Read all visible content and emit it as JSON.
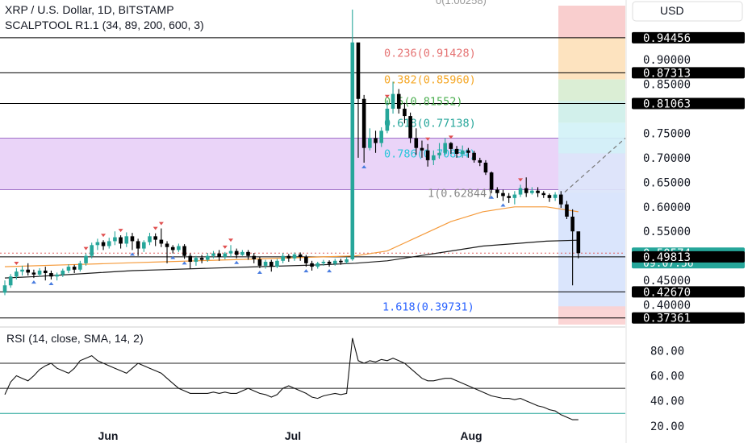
{
  "header": {
    "title": "XRP / U.S. Dollar, 1D, BITSTAMP",
    "indicator": "SCALPTOOL R1.1 (34, 89, 200, 600, 3)",
    "top_cut_label": "0(1.00258)"
  },
  "currency_label": "USD",
  "rsi_panel": {
    "label": "RSI (14, close, SMA, 14, 2)"
  },
  "colors": {
    "up": "#26a69a",
    "down": "#000000",
    "purple_zone": "#e6ccf7",
    "blue_zone": "#d4e1fb",
    "orange_line": "#f59a3a",
    "black_line": "#1a1a1a"
  },
  "chart_data": [
    {
      "type": "candlestick",
      "title": "XRP / U.S. Dollar, 1D, BITSTAMP",
      "ylim": [
        0.36,
        1.01
      ],
      "x_ticks": [
        "Jun",
        "Jul",
        "Aug"
      ],
      "y_ticks": [
        "0.90000",
        "0.85000",
        "0.75000",
        "0.70000",
        "0.65000",
        "0.60000",
        "0.55000",
        "0.45000",
        "0.40000"
      ],
      "price_badges": [
        {
          "value": "0.94456",
          "style": "dark"
        },
        {
          "value": "0.87313",
          "style": "dark"
        },
        {
          "value": "0.81063",
          "style": "dark"
        },
        {
          "value": "0.50574",
          "sub": "09:07:56",
          "style": "green"
        },
        {
          "value": "0.49813",
          "style": "dark"
        },
        {
          "value": "0.42670",
          "style": "dark"
        },
        {
          "value": "0.37361",
          "style": "dark"
        }
      ],
      "horizontal_levels": [
        0.94456,
        0.87313,
        0.81063,
        0.49813,
        0.4267,
        0.37361
      ],
      "fib_levels": [
        {
          "label": "0.236(0.91428)",
          "value": 0.91428,
          "color": "#e57373"
        },
        {
          "label": "0.382(0.85960)",
          "value": 0.8596,
          "color": "#f5a623"
        },
        {
          "label": "0.5(0.81552)",
          "value": 0.81552,
          "color": "#4caf50"
        },
        {
          "label": "0.618(0.77138)",
          "value": 0.77138,
          "color": "#26a69a"
        },
        {
          "label": "0.786(0.70854)",
          "value": 0.70854,
          "color": "#26c6da"
        },
        {
          "label": "1(0.62844)",
          "value": 0.62844,
          "color": "#888888"
        },
        {
          "label": "1.618(0.39731)",
          "value": 0.39731,
          "color": "#2962ff"
        }
      ],
      "zones": [
        {
          "name": "purple",
          "from": 0.635,
          "to": 0.74
        },
        {
          "name": "blue",
          "from": 0.39,
          "to": 0.635
        }
      ],
      "fib_band_colors": [
        "#f8c9c9",
        "#fde0b8",
        "#d7ecd0",
        "#cdeee9",
        "#d2f2f7",
        "#dde6fa",
        "#fbd0d0"
      ],
      "projection": {
        "from": 0.63,
        "to": 0.74
      },
      "candles": [
        [
          0.425,
          0.44,
          0.45,
          0.42
        ],
        [
          0.44,
          0.458,
          0.463,
          0.435
        ],
        [
          0.458,
          0.468,
          0.475,
          0.452
        ],
        [
          0.468,
          0.472,
          0.48,
          0.46
        ],
        [
          0.472,
          0.466,
          0.485,
          0.46
        ],
        [
          0.466,
          0.462,
          0.472,
          0.455
        ],
        [
          0.462,
          0.47,
          0.475,
          0.458
        ],
        [
          0.47,
          0.465,
          0.478,
          0.45
        ],
        [
          0.465,
          0.458,
          0.47,
          0.452
        ],
        [
          0.458,
          0.462,
          0.466,
          0.45
        ],
        [
          0.462,
          0.47,
          0.474,
          0.457
        ],
        [
          0.47,
          0.478,
          0.483,
          0.465
        ],
        [
          0.478,
          0.472,
          0.482,
          0.465
        ],
        [
          0.472,
          0.485,
          0.49,
          0.468
        ],
        [
          0.485,
          0.5,
          0.505,
          0.48
        ],
        [
          0.5,
          0.522,
          0.527,
          0.495
        ],
        [
          0.522,
          0.528,
          0.535,
          0.512
        ],
        [
          0.528,
          0.52,
          0.532,
          0.512
        ],
        [
          0.52,
          0.53,
          0.537,
          0.515
        ],
        [
          0.53,
          0.538,
          0.55,
          0.522
        ],
        [
          0.538,
          0.525,
          0.542,
          0.515
        ],
        [
          0.525,
          0.54,
          0.548,
          0.518
        ],
        [
          0.54,
          0.53,
          0.547,
          0.512
        ],
        [
          0.53,
          0.515,
          0.535,
          0.5
        ],
        [
          0.515,
          0.528,
          0.532,
          0.508
        ],
        [
          0.528,
          0.54,
          0.547,
          0.522
        ],
        [
          0.54,
          0.533,
          0.546,
          0.52
        ],
        [
          0.533,
          0.525,
          0.556,
          0.518
        ],
        [
          0.525,
          0.518,
          0.53,
          0.485
        ],
        [
          0.518,
          0.512,
          0.522,
          0.505
        ],
        [
          0.512,
          0.52,
          0.525,
          0.508
        ],
        [
          0.52,
          0.5,
          0.524,
          0.494
        ],
        [
          0.5,
          0.488,
          0.505,
          0.474
        ],
        [
          0.488,
          0.496,
          0.5,
          0.48
        ],
        [
          0.496,
          0.492,
          0.502,
          0.485
        ],
        [
          0.492,
          0.5,
          0.506,
          0.488
        ],
        [
          0.5,
          0.505,
          0.51,
          0.495
        ],
        [
          0.505,
          0.498,
          0.512,
          0.49
        ],
        [
          0.498,
          0.505,
          0.508,
          0.493
        ],
        [
          0.505,
          0.51,
          0.522,
          0.498
        ],
        [
          0.51,
          0.502,
          0.515,
          0.495
        ],
        [
          0.502,
          0.508,
          0.512,
          0.5
        ],
        [
          0.508,
          0.5,
          0.512,
          0.492
        ],
        [
          0.5,
          0.493,
          0.506,
          0.485
        ],
        [
          0.493,
          0.48,
          0.498,
          0.475
        ],
        [
          0.48,
          0.488,
          0.492,
          0.474
        ],
        [
          0.488,
          0.478,
          0.492,
          0.468
        ],
        [
          0.478,
          0.49,
          0.494,
          0.475
        ],
        [
          0.49,
          0.5,
          0.506,
          0.485
        ],
        [
          0.5,
          0.495,
          0.504,
          0.488
        ],
        [
          0.495,
          0.503,
          0.507,
          0.49
        ],
        [
          0.503,
          0.498,
          0.507,
          0.49
        ],
        [
          0.498,
          0.485,
          0.502,
          0.478
        ],
        [
          0.485,
          0.478,
          0.49,
          0.47
        ],
        [
          0.478,
          0.485,
          0.488,
          0.474
        ],
        [
          0.485,
          0.488,
          0.492,
          0.48
        ],
        [
          0.488,
          0.484,
          0.491,
          0.478
        ],
        [
          0.484,
          0.49,
          0.494,
          0.48
        ],
        [
          0.49,
          0.487,
          0.494,
          0.482
        ],
        [
          0.487,
          0.493,
          0.498,
          0.484
        ],
        [
          0.493,
          0.935,
          1.002,
          0.49
        ],
        [
          0.935,
          0.82,
          0.93,
          0.7
        ],
        [
          0.82,
          0.72,
          0.828,
          0.69
        ],
        [
          0.72,
          0.74,
          0.76,
          0.715
        ],
        [
          0.74,
          0.73,
          0.755,
          0.71
        ],
        [
          0.73,
          0.755,
          0.762,
          0.722
        ],
        [
          0.755,
          0.8,
          0.815,
          0.75
        ],
        [
          0.8,
          0.83,
          0.855,
          0.79
        ],
        [
          0.83,
          0.8,
          0.84,
          0.79
        ],
        [
          0.8,
          0.785,
          0.812,
          0.77
        ],
        [
          0.785,
          0.74,
          0.792,
          0.73
        ],
        [
          0.74,
          0.72,
          0.76,
          0.706
        ],
        [
          0.72,
          0.715,
          0.735,
          0.7
        ],
        [
          0.715,
          0.695,
          0.728,
          0.682
        ],
        [
          0.695,
          0.705,
          0.715,
          0.685
        ],
        [
          0.705,
          0.71,
          0.73,
          0.698
        ],
        [
          0.71,
          0.73,
          0.74,
          0.705
        ],
        [
          0.73,
          0.718,
          0.732,
          0.708
        ],
        [
          0.718,
          0.708,
          0.724,
          0.7
        ],
        [
          0.708,
          0.715,
          0.725,
          0.7
        ],
        [
          0.715,
          0.71,
          0.72,
          0.7
        ],
        [
          0.71,
          0.695,
          0.714,
          0.69
        ],
        [
          0.695,
          0.69,
          0.7,
          0.683
        ],
        [
          0.69,
          0.67,
          0.695,
          0.665
        ],
        [
          0.67,
          0.635,
          0.672,
          0.628
        ],
        [
          0.635,
          0.628,
          0.64,
          0.618
        ],
        [
          0.628,
          0.622,
          0.635,
          0.612
        ],
        [
          0.622,
          0.618,
          0.628,
          0.608
        ],
        [
          0.618,
          0.625,
          0.632,
          0.605
        ],
        [
          0.625,
          0.638,
          0.645,
          0.62
        ],
        [
          0.638,
          0.628,
          0.66,
          0.62
        ],
        [
          0.628,
          0.633,
          0.64,
          0.625
        ],
        [
          0.633,
          0.628,
          0.64,
          0.62
        ],
        [
          0.628,
          0.624,
          0.632,
          0.618
        ],
        [
          0.624,
          0.618,
          0.627,
          0.61
        ],
        [
          0.618,
          0.625,
          0.63,
          0.612
        ],
        [
          0.625,
          0.605,
          0.632,
          0.598
        ],
        [
          0.605,
          0.58,
          0.612,
          0.575
        ],
        [
          0.58,
          0.55,
          0.595,
          0.44
        ],
        [
          0.55,
          0.5057,
          0.535,
          0.495
        ]
      ],
      "up_markers": [
        2,
        14,
        17,
        20,
        26,
        27,
        38,
        39,
        66,
        73,
        77,
        89
      ],
      "down_markers": [
        5,
        8,
        22,
        29,
        31,
        40,
        44,
        52,
        56,
        62,
        84,
        86
      ],
      "sma_orange": [
        0.478,
        0.48,
        0.482,
        0.484,
        0.486,
        0.488,
        0.49,
        0.492,
        0.494,
        0.496,
        0.498,
        0.5,
        0.51,
        0.54,
        0.57,
        0.59,
        0.6,
        0.6,
        0.59
      ],
      "sma_black": [
        0.455,
        0.458,
        0.462,
        0.466,
        0.47,
        0.472,
        0.474,
        0.476,
        0.478,
        0.48,
        0.482,
        0.485,
        0.49,
        0.5,
        0.51,
        0.52,
        0.525,
        0.53,
        0.532
      ]
    },
    {
      "type": "line",
      "title": "RSI (14, close, SMA, 14, 2)",
      "ylim": [
        18,
        95
      ],
      "y_ticks": [
        "80.00",
        "60.00",
        "40.00",
        "20.00"
      ],
      "levels": [
        70,
        50,
        30
      ],
      "values": [
        45,
        55,
        60,
        58,
        56,
        60,
        65,
        68,
        70,
        66,
        64,
        62,
        66,
        72,
        74,
        76,
        72,
        70,
        68,
        66,
        64,
        62,
        66,
        70,
        68,
        66,
        64,
        62,
        58,
        54,
        50,
        48,
        46,
        46,
        46,
        46,
        47,
        46,
        47,
        46,
        46,
        48,
        50,
        48,
        46,
        45,
        43,
        45,
        50,
        52,
        50,
        48,
        46,
        43,
        42,
        44,
        45,
        46,
        45,
        46,
        90,
        72,
        70,
        72,
        71,
        73,
        72,
        74,
        72,
        70,
        66,
        62,
        58,
        56,
        56,
        57,
        58,
        58,
        56,
        54,
        52,
        50,
        48,
        46,
        44,
        43,
        42,
        42,
        41,
        42,
        40,
        38,
        36,
        35,
        33,
        32,
        29,
        27,
        25,
        25
      ]
    }
  ]
}
